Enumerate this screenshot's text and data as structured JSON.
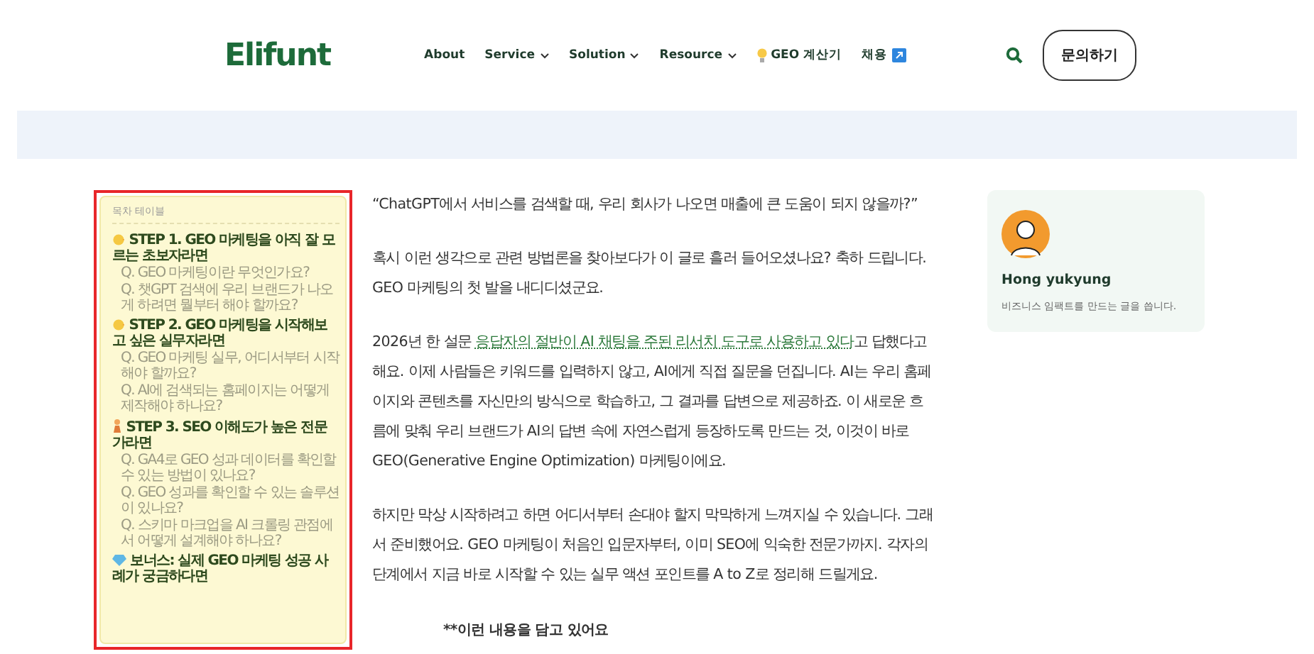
{
  "header": {
    "logo": "Elifunt",
    "nav": [
      {
        "label": "About",
        "kind": "plain"
      },
      {
        "label": "Service",
        "kind": "dropdown"
      },
      {
        "label": "Solution",
        "kind": "dropdown"
      },
      {
        "label": "Resource",
        "kind": "dropdown"
      },
      {
        "label": "GEO 계산기",
        "kind": "bulb"
      },
      {
        "label": "채용",
        "kind": "external"
      }
    ],
    "contact_button": "문의하기"
  },
  "toc": {
    "title": "목차 테이블",
    "highlighted": true,
    "items": [
      {
        "kind": "step",
        "label": "STEP 1. GEO 마케팅을 아직 잘 모르는 초보자라면"
      },
      {
        "kind": "question",
        "label": "Q. GEO 마케팅이란 무엇인가요?"
      },
      {
        "kind": "question",
        "label": "Q. 챗GPT 검색에 우리 브랜드가 나오게 하려면 뭘부터 해야 할까요?"
      },
      {
        "kind": "step",
        "label": "STEP 2. GEO 마케팅을 시작해보고 싶은 실무자라면"
      },
      {
        "kind": "question",
        "label": "Q. GEO 마케팅 실무, 어디서부터 시작해야 할까요?"
      },
      {
        "kind": "question",
        "label": "Q. AI에 검색되는 홈페이지는 어떻게 제작해야 하나요?"
      },
      {
        "kind": "step",
        "label": "STEP 3. SEO 이해도가 높은 전문가라면"
      },
      {
        "kind": "question",
        "label": "Q. GA4로 GEO 성과 데이터를 확인할 수 있는 방법이 있나요?"
      },
      {
        "kind": "question",
        "label": "Q. GEO 성과를 확인할 수 있는 솔루션이 있나요?"
      },
      {
        "kind": "question",
        "label": "Q. 스키마 마크업을 AI 크롤링 관점에서 어떻게 설계해야 하나요?"
      },
      {
        "kind": "step",
        "label": "보너스: 실제 GEO 마케팅 성공 사례가 궁금하다면"
      }
    ]
  },
  "article": {
    "quote": "“ChatGPT에서 서비스를 검색할 때, 우리 회사가 나오면 매출에 큰 도움이 되지 않을까?”",
    "intro": "혹시 이런 생각으로 관련 방법론을 찾아보다가 이 글로 흘러 들어오셨나요? 축하 드립니다. GEO 마케팅의 첫 발을 내디디셨군요.",
    "survey": {
      "before": "2026년 한 설문 ",
      "link": "응답자의 절반이 AI 채팅을 주된 리서치 도구로 사용하고 있다",
      "after": "고 답했다고 해요. 이제 사람들은 키워드를 입력하지 않고, AI에게 직접 질문을 던집니다. AI는 우리 홈페이지와 콘텐츠를 자신만의 방식으로 학습하고, 그 결과를 답변으로 제공하죠. 이 새로운 흐름에 맞춰 우리 브랜드가 AI의 답변 속에 자연스럽게 등장하도록 만드는 것, 이것이 바로 GEO(Generative Engine Optimization) 마케팅이에요."
    },
    "closing": "하지만 막상 시작하려고 하면 어디서부터 손대야 할지 막막하게 느껴지실 수 있습니다. 그래서 준비했어요. GEO 마케팅이 처음인 입문자부터, 이미 SEO에 익숙한 전문가까지. 각자의 단계에서 지금 바로 시작할 수 있는 실무 액션 포인트를 A to Z로 정리해 드릴게요.",
    "subheading": "**이런 내용을 담고 있어요"
  },
  "author": {
    "name": "Hong yukyung",
    "bio": "비즈니스 임팩트를 만드는 글을 씁니다."
  }
}
